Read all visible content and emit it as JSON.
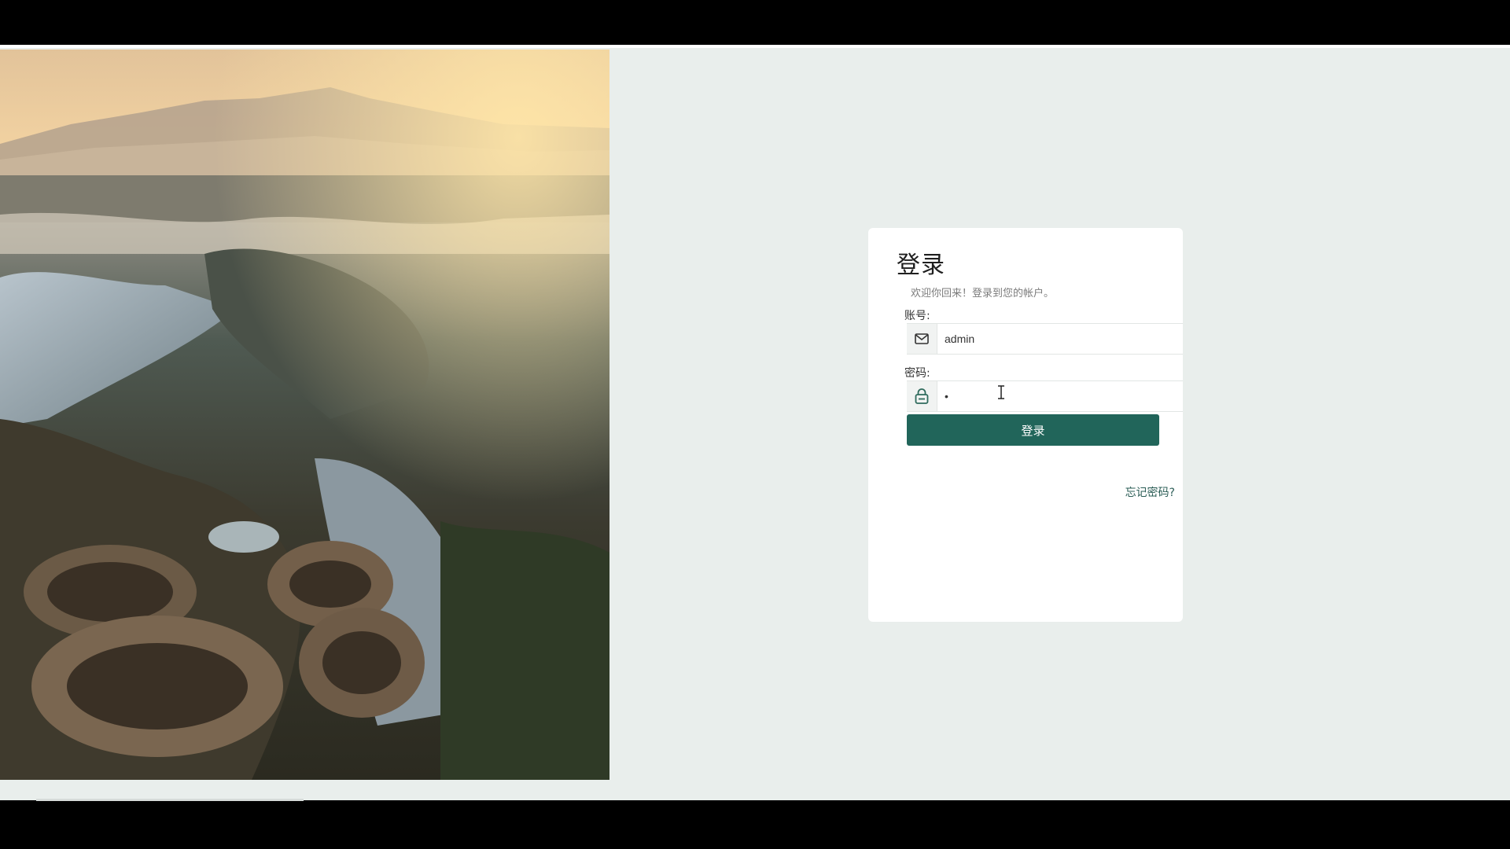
{
  "login": {
    "title": "登录",
    "subtitle": "欢迎你回来！登录到您的帐户。",
    "account_label": "账号:",
    "account_value": "admin",
    "password_label": "密码:",
    "password_value": "•",
    "submit_label": "登录",
    "forgot_label": "忘记密码?"
  },
  "icons": {
    "account": "mail-icon",
    "password": "lock-icon"
  },
  "colors": {
    "primary": "#21655a",
    "page_background": "#e9eeec",
    "card_background": "#ffffff"
  }
}
